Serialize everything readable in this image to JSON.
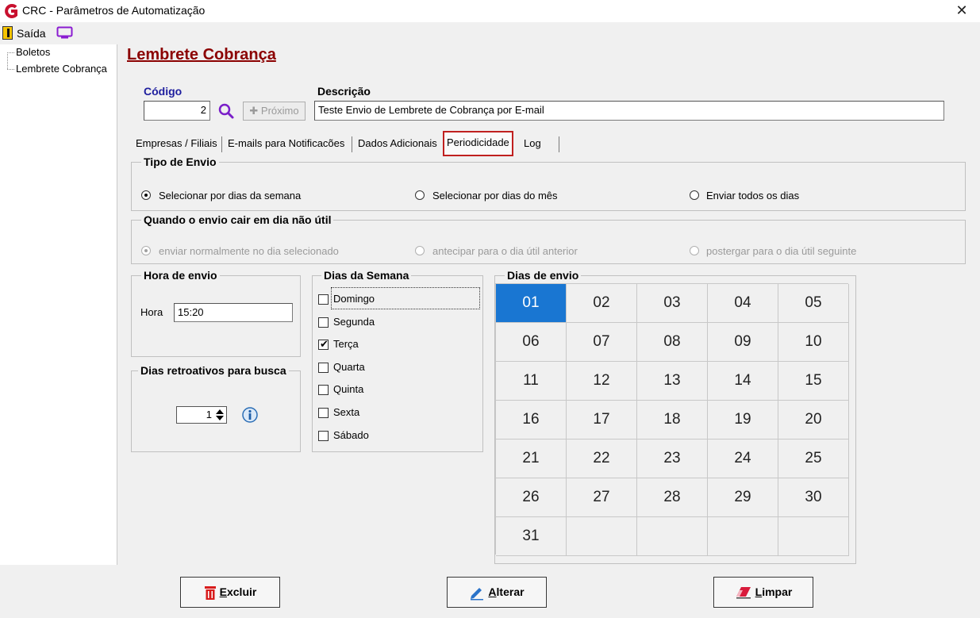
{
  "window": {
    "title": "CRC - Parâmetros de Automatização",
    "close": "✕"
  },
  "toolbar": {
    "exit_label": "Saída"
  },
  "tree": {
    "items": [
      "Boletos",
      "Lembrete Cobrança"
    ]
  },
  "form": {
    "title": "Lembrete Cobrança",
    "code_label": "Código",
    "code_value": "2",
    "next_label": "Próximo",
    "next_prefix": "✚",
    "description_label": "Descrição",
    "description_value": "Teste Envio de Lembrete de Cobrança por E-mail"
  },
  "tabs": [
    {
      "label": "Empresas / Filiais"
    },
    {
      "label": "E-mails para Notificacões"
    },
    {
      "label": "Dados Adicionais"
    },
    {
      "label": "Periodicidade",
      "active": true
    },
    {
      "label": "Log"
    }
  ],
  "send_type": {
    "title": "Tipo de Envio",
    "options": [
      "Selecionar por dias da semana",
      "Selecionar por dias do mês",
      "Enviar todos os dias"
    ],
    "selected": 0
  },
  "non_business": {
    "title": "Quando o envio cair em dia não útil",
    "options": [
      "enviar normalmente no dia selecionado",
      "antecipar para o dia útil anterior",
      "postergar para o dia útil seguinte"
    ],
    "selected": 0,
    "enabled": false
  },
  "send_time": {
    "title": "Hora de envio",
    "label": "Hora",
    "value": "15:20"
  },
  "retro_days": {
    "title": "Dias retroativos para busca",
    "value": "1"
  },
  "weekdays": {
    "title": "Dias da Semana",
    "items": [
      {
        "label": "Domingo",
        "checked": false
      },
      {
        "label": "Segunda",
        "checked": false
      },
      {
        "label": "Terça",
        "checked": true
      },
      {
        "label": "Quarta",
        "checked": false
      },
      {
        "label": "Quinta",
        "checked": false
      },
      {
        "label": "Sexta",
        "checked": false
      },
      {
        "label": "Sábado",
        "checked": false
      }
    ],
    "check_glyph": "✔"
  },
  "send_days": {
    "title": "Dias de envio",
    "days": [
      "01",
      "02",
      "03",
      "04",
      "05",
      "06",
      "07",
      "08",
      "09",
      "10",
      "11",
      "12",
      "13",
      "14",
      "15",
      "16",
      "17",
      "18",
      "19",
      "20",
      "21",
      "22",
      "23",
      "24",
      "25",
      "26",
      "27",
      "28",
      "29",
      "30",
      "31"
    ],
    "selected": "01",
    "selected_color": "#1976d2"
  },
  "buttons": {
    "delete": {
      "first": "E",
      "rest": "xcluir"
    },
    "edit": {
      "first": "A",
      "rest": "lterar"
    },
    "clear": {
      "first": "L",
      "rest": "impar"
    }
  },
  "colors": {
    "title_red": "#8b0000",
    "code_label_blue": "#1e1e9e",
    "tab_highlight": "#c0201f"
  }
}
